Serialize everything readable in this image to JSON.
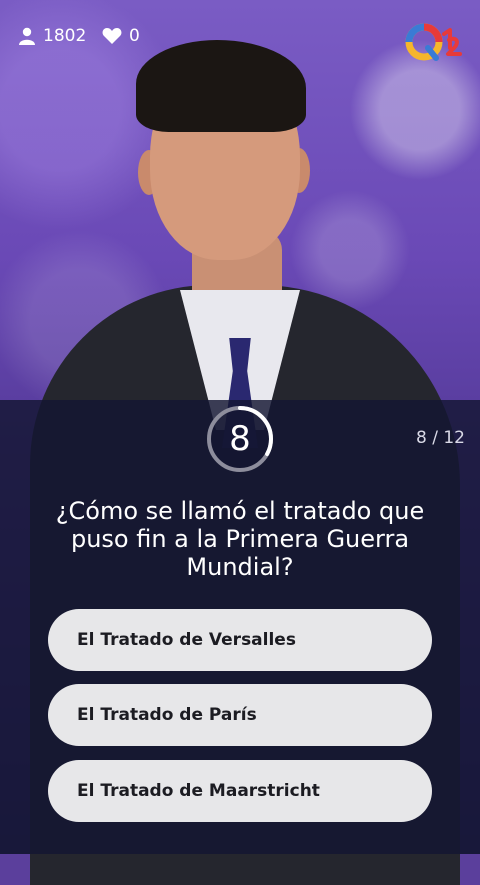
{
  "stats": {
    "players": "1802",
    "lives": "0"
  },
  "game": {
    "timer": "8",
    "progress": "8 / 12",
    "timer_fraction": 0.33
  },
  "question": {
    "text": "¿Cómo se llamó el tratado que puso fin a la Primera Guerra Mundial?"
  },
  "answers": [
    {
      "label": "El Tratado de Versalles"
    },
    {
      "label": "El Tratado de París"
    },
    {
      "label": "El Tratado de Maarstricht"
    }
  ],
  "icons": {
    "players": "user-icon",
    "lives": "heart-icon",
    "logo": "q12-logo"
  },
  "colors": {
    "timer_ring": "#8d8d9c",
    "answer_bg": "#e7e7e9"
  }
}
